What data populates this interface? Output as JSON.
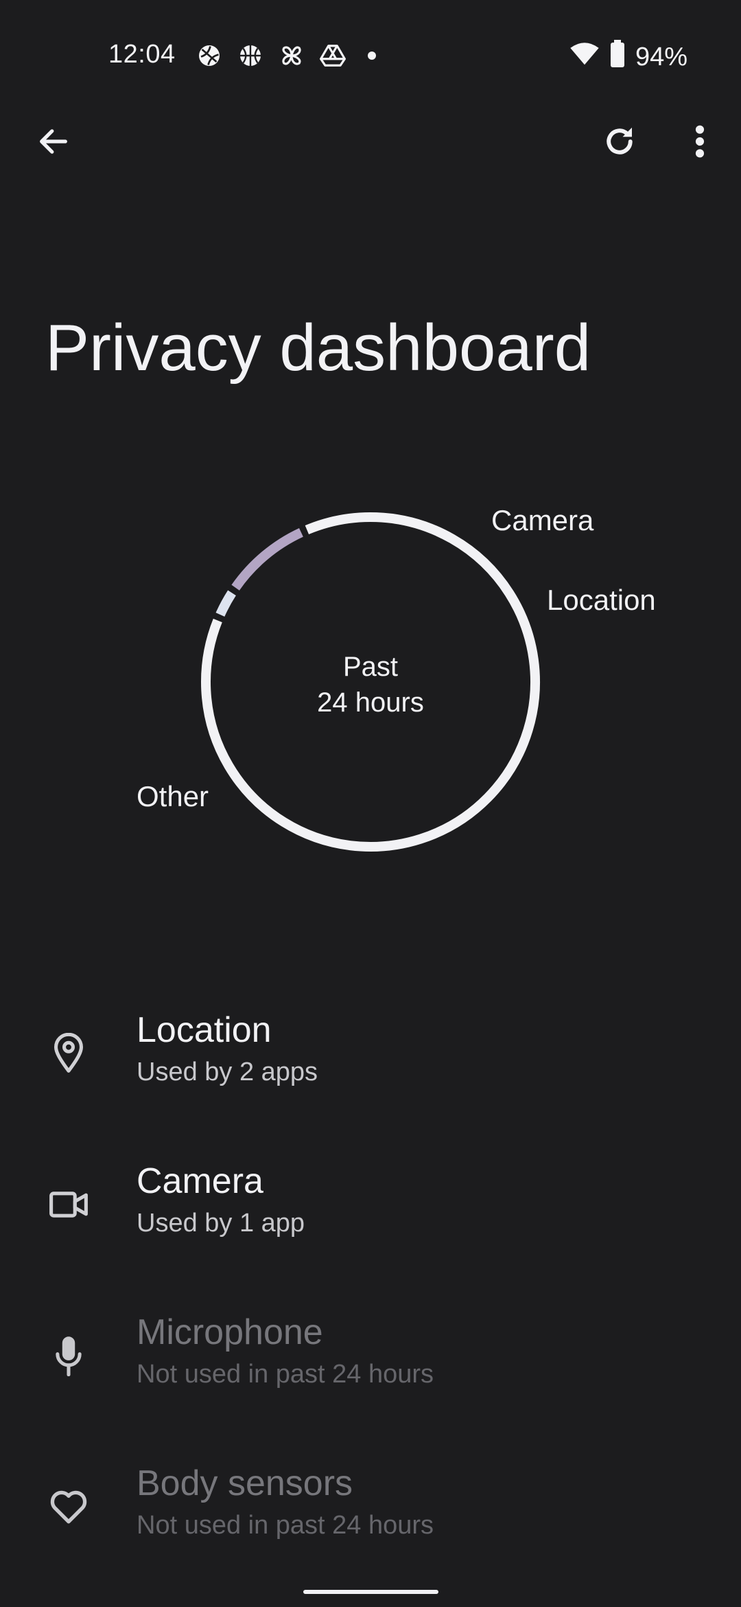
{
  "status_bar": {
    "time": "12:04",
    "battery": "94%",
    "left_icons": [
      "sports-ball-icon",
      "basketball-icon",
      "pinwheel-icon",
      "drive-icon",
      "notification-dot-icon"
    ],
    "right_icons": [
      "wifi-icon",
      "battery-icon"
    ]
  },
  "app_bar": {
    "back_icon": "arrow-back-icon",
    "refresh_icon": "refresh-icon",
    "more_icon": "more-vert-icon"
  },
  "page": {
    "title": "Privacy dashboard"
  },
  "chart_data": {
    "type": "pie",
    "center_label_line1": "Past",
    "center_label_line2": "24 hours",
    "categories": [
      "Camera",
      "Location",
      "Other"
    ],
    "values": [
      3,
      9,
      88
    ],
    "colors": {
      "Camera": "#dde3ef",
      "Location": "#b3a5c4",
      "Other": "#f2f2f5"
    }
  },
  "permissions": [
    {
      "title": "Location",
      "subtitle": "Used by 2 apps",
      "icon": "location-pin-icon",
      "enabled": true
    },
    {
      "title": "Camera",
      "subtitle": "Used by 1 app",
      "icon": "video-camera-icon",
      "enabled": true
    },
    {
      "title": "Microphone",
      "subtitle": "Not used in past 24 hours",
      "icon": "microphone-icon",
      "enabled": false
    },
    {
      "title": "Body sensors",
      "subtitle": "Not used in past 24 hours",
      "icon": "heart-icon",
      "enabled": false
    }
  ]
}
